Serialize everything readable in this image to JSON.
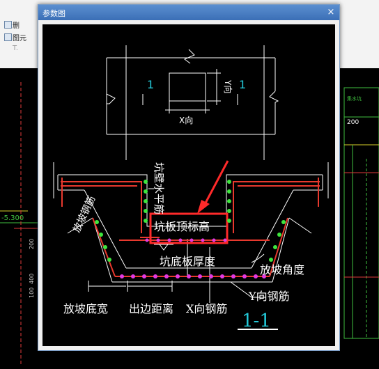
{
  "dialog": {
    "title": "参数图",
    "close_glyph": "×"
  },
  "plan": {
    "left_mark": "1",
    "right_mark": "1",
    "x_label": "X向",
    "y_label": "Y向"
  },
  "section": {
    "wall_horizontal_rebar": "坑壁水平筋",
    "pit_slab_top_elev": "坑板顶标高",
    "pit_bottom_thickness": "坑底板厚度",
    "slope_angle": "放坡角度",
    "y_rebar": "Y向钢筋",
    "slope_bottom_width": "放坡底宽",
    "edge_distance": "出边距离",
    "x_rebar": "X向钢筋",
    "slope_rebar": "放坡钢筋",
    "section_id": "1-1"
  },
  "background": {
    "elevation": "-5.300",
    "dim_200": "200",
    "ribbon_items": [
      "删",
      "图元",
      "T."
    ]
  },
  "colors": {
    "rebar_red": "#e8392e",
    "rebar_dot_green": "#3ee63e",
    "rebar_dot_magenta": "#e23ae2",
    "highlight_red": "#ff2a2a",
    "drawing_white": "#ffffff",
    "mark_cyan": "#23c8d8"
  }
}
